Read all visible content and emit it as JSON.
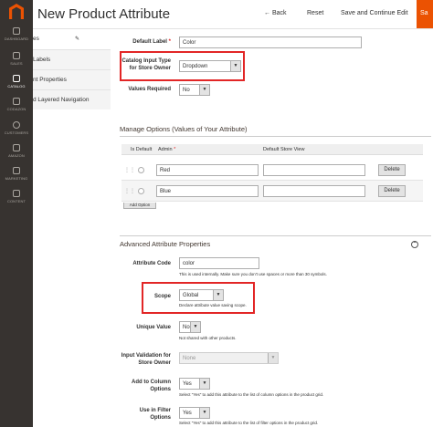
{
  "nav": {
    "items": [
      {
        "label": "DASHBOARD",
        "icon": "dashboard-icon"
      },
      {
        "label": "SALES",
        "icon": "dollar-icon"
      },
      {
        "label": "CATALOG",
        "icon": "cube-icon"
      },
      {
        "label": "CODAZON",
        "icon": "codazon-icon"
      },
      {
        "label": "CUSTOMERS",
        "icon": "customers-icon"
      },
      {
        "label": "AMAZON",
        "icon": "amazon-icon"
      },
      {
        "label": "MARKETING",
        "icon": "megaphone-icon"
      },
      {
        "label": "CONTENT",
        "icon": "content-icon"
      }
    ]
  },
  "header": {
    "title": "New Product Attribute",
    "back_label": "Back",
    "back_icon": "arrow-left-icon",
    "reset_label": "Reset",
    "save_continue_label": "Save and Continue Edit",
    "save_label": "Sa"
  },
  "tabs": [
    {
      "label": "es"
    },
    {
      "label": "Labels"
    },
    {
      "label": "nt Properties"
    },
    {
      "label": "d Layered Navigation"
    }
  ],
  "properties": {
    "default_label": {
      "label": "Default Label",
      "required": "*",
      "value": "Color"
    },
    "input_type": {
      "label_line1": "Catalog Input Type",
      "label_line2": "for Store Owner",
      "value": "Dropdown"
    },
    "values_required": {
      "label": "Values Required",
      "value": "No"
    }
  },
  "manage_options": {
    "title": "Manage Options (Values of Your Attribute)",
    "col_default": "Is Default",
    "col_admin": "Admin",
    "col_admin_required": "*",
    "col_store": "Default Store View",
    "rows": [
      {
        "admin": "Red",
        "store": "",
        "delete": "Delete"
      },
      {
        "admin": "Blue",
        "store": "",
        "delete": "Delete"
      }
    ],
    "add_option": "Add Option"
  },
  "advanced": {
    "title": "Advanced Attribute Properties",
    "attribute_code": {
      "label": "Attribute Code",
      "value": "color",
      "note": "This is used internally. Make sure you don't use spaces or more than 30 symbols."
    },
    "scope": {
      "label": "Scope",
      "value": "Global",
      "note": "Declare attribute value saving scope."
    },
    "unique_value": {
      "label": "Unique Value",
      "value": "No",
      "note": "Not shared with other products."
    },
    "input_validation": {
      "label_line1": "Input Validation for",
      "label_line2": "Store Owner",
      "value": "None"
    },
    "add_to_column": {
      "label_line1": "Add to Column",
      "label_line2": "Options",
      "value": "Yes",
      "note": "Select \"Yes\" to add this attribute to the list of column options in the product grid."
    },
    "use_in_filter": {
      "label_line1": "Use in Filter",
      "label_line2": "Options",
      "value": "Yes",
      "note": "Select \"Yes\" to add this attribute to the list of filter options in the product grid."
    }
  },
  "colors": {
    "accent": "#eb5202",
    "nav_bg": "#373330",
    "highlight": "#e22626"
  }
}
